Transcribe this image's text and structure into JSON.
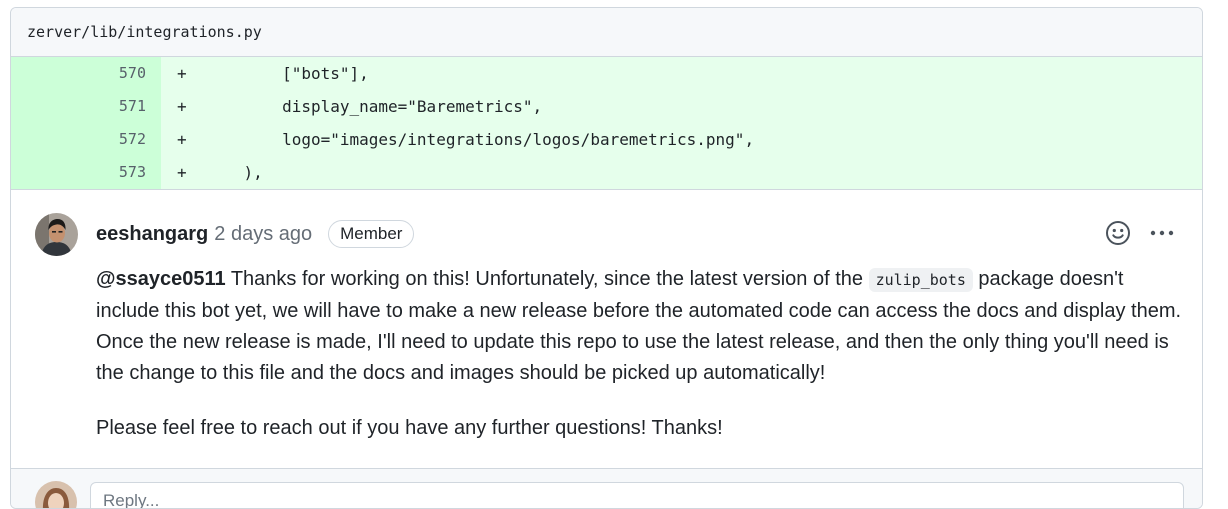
{
  "file": {
    "path": "zerver/lib/integrations.py"
  },
  "diff": {
    "lines": [
      {
        "num": "570",
        "marker": "+",
        "code": "        [\"bots\"],"
      },
      {
        "num": "571",
        "marker": "+",
        "code": "        display_name=\"Baremetrics\","
      },
      {
        "num": "572",
        "marker": "+",
        "code": "        logo=\"images/integrations/logos/baremetrics.png\","
      },
      {
        "num": "573",
        "marker": "+",
        "code": "    ),"
      }
    ]
  },
  "comment": {
    "author": "eeshangarg",
    "time": "2 days ago",
    "badge": "Member",
    "mention": "@ssayce0511",
    "text_part1": " Thanks for working on this! Unfortunately, since the latest version of the ",
    "inline_code": "zulip_bots",
    "text_part2": " package doesn't include this bot yet, we will have to make a new release before the automated code can access the docs and display them. Once the new release is made, I'll need to update this repo to use the latest release, and then the only thing you'll need is the change to this file and the docs and images should be picked up automatically!",
    "paragraph2": "Please feel free to reach out if you have any further questions! Thanks!",
    "icons": {
      "reaction": "smiley-icon",
      "more": "kebab-icon"
    }
  },
  "reply": {
    "placeholder": "Reply..."
  },
  "colors": {
    "added_line_bg": "#e6ffec",
    "added_linenum_bg": "#ccffd8",
    "border": "#d0d7de",
    "muted_text": "#656d76"
  }
}
